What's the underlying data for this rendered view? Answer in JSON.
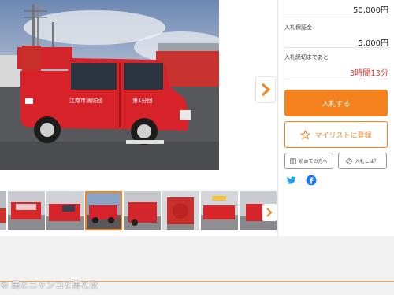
{
  "panel": {
    "current_price": "50,000円",
    "deposit_label": "入札保証金",
    "deposit_value": "5,000円",
    "deadline_label": "入札締切まであと",
    "deadline_value": "3時間13分",
    "bid_button": "入札する",
    "mylist_button": "マイリストに登録",
    "first_time_button": "初めての方へ",
    "what_is_bid_button": "入札とは？"
  },
  "photo": {
    "door_text": "江南市消防団",
    "unit_text": "第1分団"
  },
  "watermark": "© 馬とニャンコと男と女",
  "colors": {
    "accent": "#f5821f",
    "deadline": "#e53935",
    "twitter": "#1da1f2",
    "facebook": "#1877f2"
  },
  "icons": [
    "chevron-right-icon",
    "star-icon",
    "book-icon",
    "help-circle-icon",
    "twitter-icon",
    "facebook-icon"
  ]
}
